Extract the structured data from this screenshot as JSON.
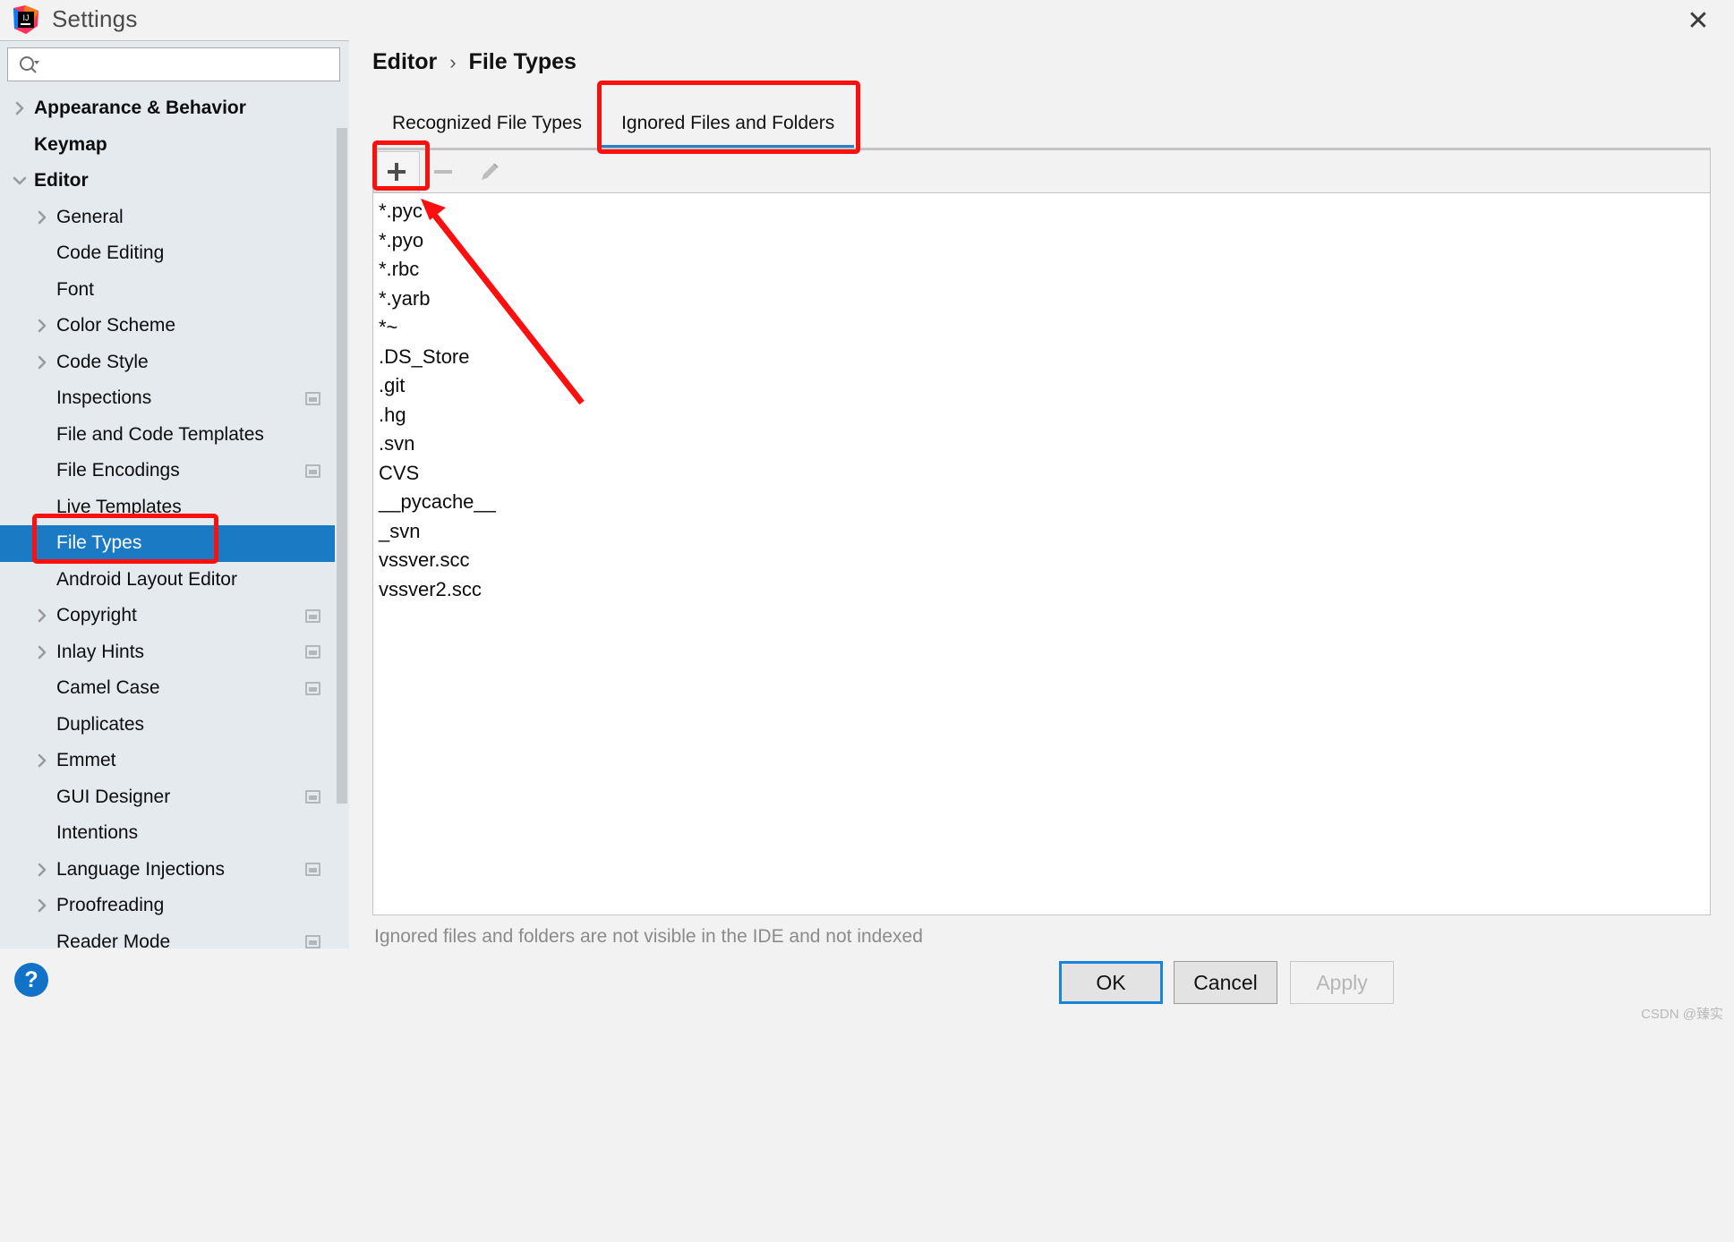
{
  "window": {
    "title": "Settings",
    "logo_icon": "intellij-idea-logo",
    "close_icon": "close-icon"
  },
  "search": {
    "value": "",
    "placeholder": "",
    "icon": "search-icon"
  },
  "sidebar": {
    "items": [
      {
        "label": "Appearance & Behavior",
        "indent": 38,
        "twisty": "chevron-right",
        "bold": true,
        "selected": false,
        "badge": false
      },
      {
        "label": "Keymap",
        "indent": 38,
        "twisty": "none",
        "bold": true,
        "selected": false,
        "badge": false
      },
      {
        "label": "Editor",
        "indent": 38,
        "twisty": "chevron-down",
        "bold": true,
        "selected": false,
        "badge": false
      },
      {
        "label": "General",
        "indent": 63,
        "twisty": "chevron-right",
        "bold": false,
        "selected": false,
        "badge": false
      },
      {
        "label": "Code Editing",
        "indent": 63,
        "twisty": "none",
        "bold": false,
        "selected": false,
        "badge": false
      },
      {
        "label": "Font",
        "indent": 63,
        "twisty": "none",
        "bold": false,
        "selected": false,
        "badge": false
      },
      {
        "label": "Color Scheme",
        "indent": 63,
        "twisty": "chevron-right",
        "bold": false,
        "selected": false,
        "badge": false
      },
      {
        "label": "Code Style",
        "indent": 63,
        "twisty": "chevron-right",
        "bold": false,
        "selected": false,
        "badge": false
      },
      {
        "label": "Inspections",
        "indent": 63,
        "twisty": "none",
        "bold": false,
        "selected": false,
        "badge": true
      },
      {
        "label": "File and Code Templates",
        "indent": 63,
        "twisty": "none",
        "bold": false,
        "selected": false,
        "badge": false
      },
      {
        "label": "File Encodings",
        "indent": 63,
        "twisty": "none",
        "bold": false,
        "selected": false,
        "badge": true
      },
      {
        "label": "Live Templates",
        "indent": 63,
        "twisty": "none",
        "bold": false,
        "selected": false,
        "badge": false
      },
      {
        "label": "File Types",
        "indent": 63,
        "twisty": "none",
        "bold": false,
        "selected": true,
        "badge": false
      },
      {
        "label": "Android Layout Editor",
        "indent": 63,
        "twisty": "none",
        "bold": false,
        "selected": false,
        "badge": false
      },
      {
        "label": "Copyright",
        "indent": 63,
        "twisty": "chevron-right",
        "bold": false,
        "selected": false,
        "badge": true
      },
      {
        "label": "Inlay Hints",
        "indent": 63,
        "twisty": "chevron-right",
        "bold": false,
        "selected": false,
        "badge": true
      },
      {
        "label": "Camel Case",
        "indent": 63,
        "twisty": "none",
        "bold": false,
        "selected": false,
        "badge": true
      },
      {
        "label": "Duplicates",
        "indent": 63,
        "twisty": "none",
        "bold": false,
        "selected": false,
        "badge": false
      },
      {
        "label": "Emmet",
        "indent": 63,
        "twisty": "chevron-right",
        "bold": false,
        "selected": false,
        "badge": false
      },
      {
        "label": "GUI Designer",
        "indent": 63,
        "twisty": "none",
        "bold": false,
        "selected": false,
        "badge": true
      },
      {
        "label": "Intentions",
        "indent": 63,
        "twisty": "none",
        "bold": false,
        "selected": false,
        "badge": false
      },
      {
        "label": "Language Injections",
        "indent": 63,
        "twisty": "chevron-right",
        "bold": false,
        "selected": false,
        "badge": true
      },
      {
        "label": "Proofreading",
        "indent": 63,
        "twisty": "chevron-right",
        "bold": false,
        "selected": false,
        "badge": false
      },
      {
        "label": "Reader Mode",
        "indent": 63,
        "twisty": "none",
        "bold": false,
        "selected": false,
        "badge": true
      }
    ]
  },
  "main": {
    "breadcrumb": {
      "root": "Editor",
      "separator": "›",
      "current": "File Types"
    },
    "tabs": [
      {
        "label": "Recognized File Types",
        "active": false
      },
      {
        "label": "Ignored Files and Folders",
        "active": true
      }
    ],
    "toolbar": [
      {
        "name": "add-button",
        "icon": "plus-icon",
        "enabled": true
      },
      {
        "name": "remove-button",
        "icon": "minus-icon",
        "enabled": false
      },
      {
        "name": "edit-button",
        "icon": "pencil-icon",
        "enabled": false
      }
    ],
    "ignored_list": [
      "*.pyc",
      "*.pyo",
      "*.rbc",
      "*.yarb",
      "*~",
      ".DS_Store",
      ".git",
      ".hg",
      ".svn",
      "CVS",
      "__pycache__",
      "_svn",
      "vssver.scc",
      "vssver2.scc"
    ],
    "note": "Ignored files and folders are not visible in the IDE and not indexed"
  },
  "footer": {
    "help_icon": "help-question-icon",
    "buttons": [
      {
        "label": "OK",
        "state": "default-focused"
      },
      {
        "label": "Cancel",
        "state": "normal"
      },
      {
        "label": "Apply",
        "state": "disabled"
      }
    ],
    "watermark": "CSDN @臻实"
  },
  "annotations": {
    "colors": {
      "highlight": "#fb0f0f",
      "selection": "#1b7ac4",
      "tab_underline": "#2a7fc9"
    },
    "boxes": [
      {
        "name": "ignored-tab-highlight"
      },
      {
        "name": "add-button-highlight"
      },
      {
        "name": "file-types-item-highlight"
      }
    ],
    "arrow": {
      "name": "pointer-arrow-to-add-button"
    }
  }
}
